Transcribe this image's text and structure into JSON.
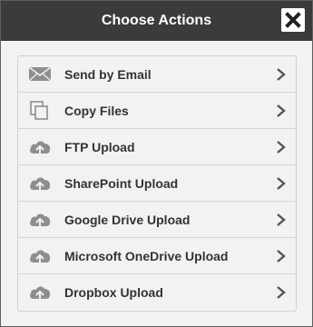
{
  "dialog": {
    "title": "Choose Actions",
    "close_icon": "close-icon"
  },
  "actions": [
    {
      "label": "Send by Email",
      "icon": "email-icon"
    },
    {
      "label": "Copy Files",
      "icon": "copy-icon"
    },
    {
      "label": "FTP Upload",
      "icon": "cloud-upload-icon"
    },
    {
      "label": "SharePoint Upload",
      "icon": "cloud-upload-icon"
    },
    {
      "label": "Google Drive Upload",
      "icon": "cloud-upload-icon"
    },
    {
      "label": "Microsoft OneDrive Upload",
      "icon": "cloud-upload-icon"
    },
    {
      "label": "Dropbox Upload",
      "icon": "cloud-upload-icon"
    }
  ],
  "colors": {
    "header_bg": "#3b3b3b",
    "dialog_bg": "#f2f2f2",
    "icon_gray": "#8e8e8e",
    "text": "#333333"
  }
}
